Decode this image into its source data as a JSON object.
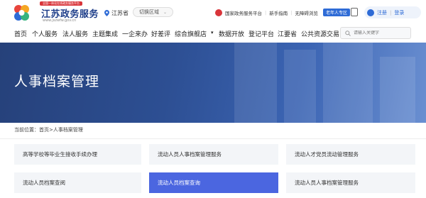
{
  "header": {
    "logo": {
      "slogan": "全国一体化在线政务服务平台",
      "title": "江苏政务服务",
      "url": "www.jszwfw.gov.cn"
    },
    "location": "江苏省",
    "switch_region": "切换区域",
    "gov_links": [
      "国家政务服务平台",
      "新手指南",
      "无障碍浏览"
    ],
    "elder_mode": "老年人专区",
    "login": {
      "register": "注册",
      "login": "登录"
    }
  },
  "nav": {
    "items": [
      "首页",
      "个人服务",
      "法人服务",
      "主题集成",
      "一企来办",
      "好差评",
      "综合旗舰店",
      "数据开放",
      "登记平台",
      "江要省",
      "公共资源交易"
    ],
    "search_placeholder": "请输入关键字"
  },
  "banner": {
    "title": "人事档案管理"
  },
  "breadcrumb": {
    "prefix": "当前位置：",
    "home": "首页",
    "sep": ">",
    "current": "人事档案管理"
  },
  "cards": [
    {
      "label": "高等学校等毕业生接收手续办理"
    },
    {
      "label": "流动人员人事档案管理服务"
    },
    {
      "label": "流动人才党员流动管理服务"
    },
    {
      "label": "流动人员档案查阅"
    },
    {
      "label": "流动人员档案查询"
    },
    {
      "label": "流动人员人事档案管理服务"
    }
  ],
  "colors": {
    "brand": "#1f3f8a",
    "accent": "#2e6bd6",
    "active_card": "#4b66e0"
  }
}
